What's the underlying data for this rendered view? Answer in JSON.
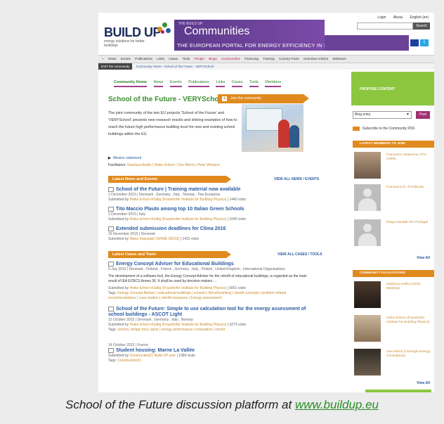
{
  "header": {
    "logo": "BUILD UP",
    "logo_sub": "energy solutions for better buildings",
    "banner_small": "THE BUILD UP",
    "banner_title": "Communities",
    "banner_tagline": "THE EUROPEAN PORTAL FOR ENERGY EFFICIENCY IN BUILDINGS",
    "toplinks": [
      "Login",
      "About",
      "English (en)"
    ],
    "search_button": "Search"
  },
  "nav": {
    "items": [
      "News",
      "Events",
      "Publications",
      "Links",
      "Cases",
      "Tools",
      "People",
      "Blogs",
      "Communities",
      "Financing",
      "Training",
      "Country Facts",
      "Overview Articles",
      "Webinars"
    ],
    "pink_items": [
      "People",
      "Blogs",
      "Communities"
    ]
  },
  "crumb": {
    "exit": "EXIT the community",
    "path": "Community Home › School of the Future - VERYSchool"
  },
  "tabs": [
    "Community Home",
    "News",
    "Events",
    "Publications",
    "Links",
    "Cases",
    "Tools",
    "Members"
  ],
  "main": {
    "title": "School of the Future - VERYSchool",
    "join": "Join this community",
    "intro": "The joint community of the two EU projects 'School of the Future' and 'VERYSchool' presents new research results and shining examples of how to reach the future high performance building level for new and existing school buildings within the EU.",
    "mission": "Mission statement",
    "facilitators_label": "Facilitators:",
    "facilitators": "Gianluca Avella | Heike Erhorn | Ove Mörck | Peter Wouters"
  },
  "news": {
    "header": "Latest News and Events",
    "view_all": "VIEW ALL NEWS / EVENTS",
    "items": [
      {
        "title": "School of the Future | Training material now available",
        "sub": "1 December 2015 | Denmark , Germany , Italy , Norway , Pan European",
        "by": "Submitted by",
        "author": "Heike Erhorn-Kluttig (Fraunhofer Institute for Building Physics)",
        "visits": "| 1440 visits"
      },
      {
        "title": "Tito Maccio Plauto among top 10 Italian Green Schools",
        "sub": "1 December 2015 | Italy",
        "by": "Submitted by",
        "author": "Heike Erhorn-Kluttig (Fraunhofer Institute for Building Physics)",
        "visits": "| 1040 visits"
      },
      {
        "title": "Extended submission deadlines for Clima 2016",
        "sub": "25 November 2015 | Denmark",
        "by": "Submitted by",
        "author": "Maria Kapsalaki (SHINE EEOS)",
        "visits": "| 1423 visits"
      }
    ]
  },
  "cases": {
    "header": "Latest Cases and Tools",
    "view_all": "VIEW ALL CASES / TOOLS",
    "items": [
      {
        "title": "Energy Concept Adviser for Educational Buildings",
        "sub": "9 July 2010 | Denmark , Finland , France , Germany , Italy , Poland , United Kingdom , International Organisations",
        "desc": "The development of a software tool, the Energy Concept Adviser for the retrofit of educational buildings, is regarded as the main result of IEA ECBCS Annex 36. It shall be used by decision makers ...",
        "by": "Submitted by",
        "author": "Heike Erhorn-Kluttig (Fraunhofer Institute for Building Physics)",
        "visits": "| 5061 visits",
        "tags_label": "Tags:",
        "tags": "Energy Concept Adviser | educational buildings | schools | Benchmarking | retrofit concepts | problem related recommendations | case studies | retrofit measures | Energy assessment"
      },
      {
        "title": "School of the Future: Simple to use calculation tool for the energy assessment of school buildings - ASCOT Light",
        "sub": "13 October 2015 | Denmark , Germany , Italy , Norway",
        "by": "Submitted by",
        "author": "Heike Erhorn-Kluttig (Fraunhofer Institute for Building Physics)",
        "visits": "| 5273 visits",
        "tags_label": "Tags:",
        "tags": "school | simple tool | quick | energy performance | renovation | retrofit"
      },
      {
        "title": "Student housing: Marne La Vallée",
        "sub": "14 October 2015 | France",
        "by": "Submitted by",
        "author": "Construction21 Build UP user",
        "visits": "| 1084 visits",
        "tags_label": "Tags:",
        "tags": "Construction21"
      }
    ]
  },
  "sidebar": {
    "propose": "PROPOSE CONTENT",
    "select_value": "Blog entry",
    "post_button": "Post",
    "subscribe": "Subscribe to the Community RSS",
    "members_header": "LATEST MEMBERS TO JOIN",
    "members": [
      {
        "name": "Francesco Salamone UTC-CNRS"
      },
      {
        "name": "Francesca R. d'Ambrosio"
      },
      {
        "name": "Plaiya Sandall 267 Portugal"
      }
    ],
    "members_view_all": "View All",
    "facilitators_header": "COMMUNITY FACILITATORS",
    "facilitators": [
      {
        "name": "Gianluca Avella (AESS Modena)"
      },
      {
        "name": "Heike Erhorn (Fraunhofer Institute for Building Physics)"
      },
      {
        "name": "Ove Mörck (Cenergia Energy Consultants)"
      }
    ],
    "facilitators_view_all": "View All"
  },
  "caption": {
    "text": "School of the Future discussion platform at ",
    "link": "www.buildup.eu"
  },
  "colors": {
    "accent_orange": "#e08a1e",
    "accent_green": "#8cc63f",
    "title_green": "#3b8d2f",
    "banner_purple": "#6a4298",
    "link_blue": "#2a5aa0"
  }
}
